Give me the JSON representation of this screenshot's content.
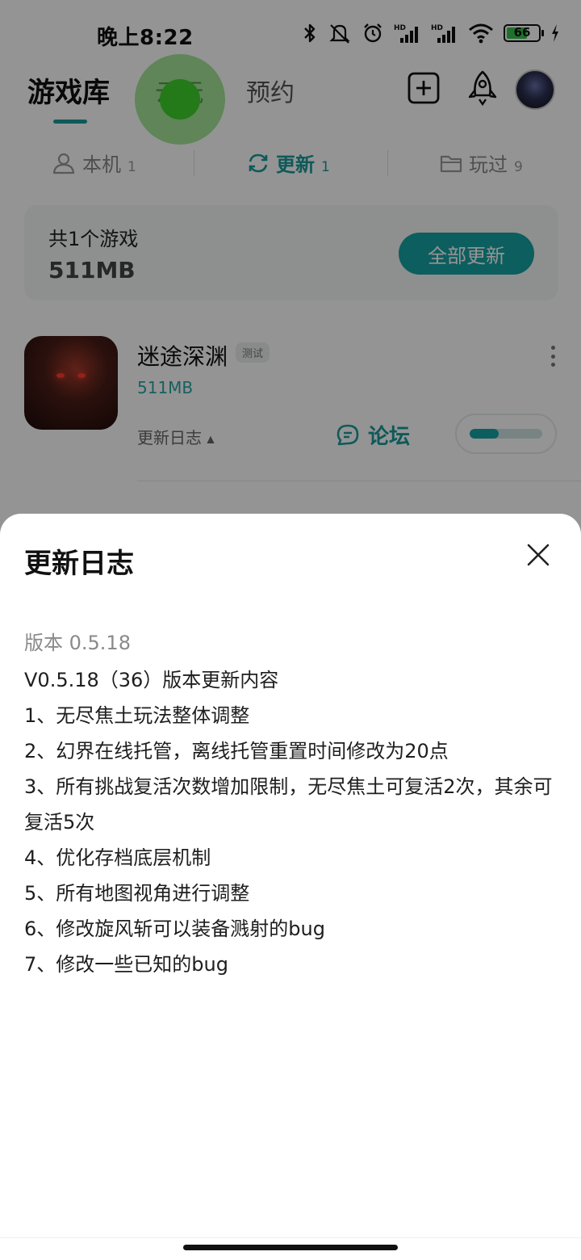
{
  "status_bar": {
    "time": "晚上8:22",
    "battery_level": "66",
    "icons": [
      "bluetooth-icon",
      "mute-icon",
      "alarm-icon",
      "signal-hd-icon",
      "signal-hd-icon",
      "wifi-icon",
      "battery-icon",
      "charging-icon"
    ]
  },
  "top_nav": {
    "tabs": [
      {
        "label": "游戏库",
        "active": true
      },
      {
        "label": "云玩",
        "active": false
      },
      {
        "label": "预约",
        "active": false
      }
    ],
    "actions": [
      "add-icon",
      "rocket-icon",
      "avatar"
    ]
  },
  "sub_tabs": [
    {
      "label": "本机",
      "count": "1",
      "icon": "user-icon"
    },
    {
      "label": "更新",
      "count": "1",
      "icon": "refresh-icon",
      "active": true
    },
    {
      "label": "玩过",
      "count": "9",
      "icon": "folder-icon"
    }
  ],
  "summary": {
    "count_text": "共1个游戏",
    "total_size": "511MB",
    "update_all_label": "全部更新"
  },
  "game": {
    "title": "迷途深渊",
    "tag": "测试",
    "size": "511MB",
    "changelog_link": "更新日志",
    "forum_label": "论坛",
    "download_progress": 0.4
  },
  "sheet": {
    "title": "更新日志",
    "version": "版本 0.5.18",
    "notes": [
      "V0.5.18（36）版本更新内容",
      "1、无尽焦土玩法整体调整",
      "2、幻界在线托管，离线托管重置时间修改为20点",
      "3、所有挑战复活次数增加限制，无尽焦土可复活2次，其余可复活5次",
      "4、优化存档底层机制",
      "5、所有地图视角进行调整",
      "6、修改旋风斩可以装备溅射的bug",
      "7、修改一些已知的bug"
    ]
  },
  "colors": {
    "accent": "#17a2a2",
    "touch_indicator": "#3fd12a"
  }
}
